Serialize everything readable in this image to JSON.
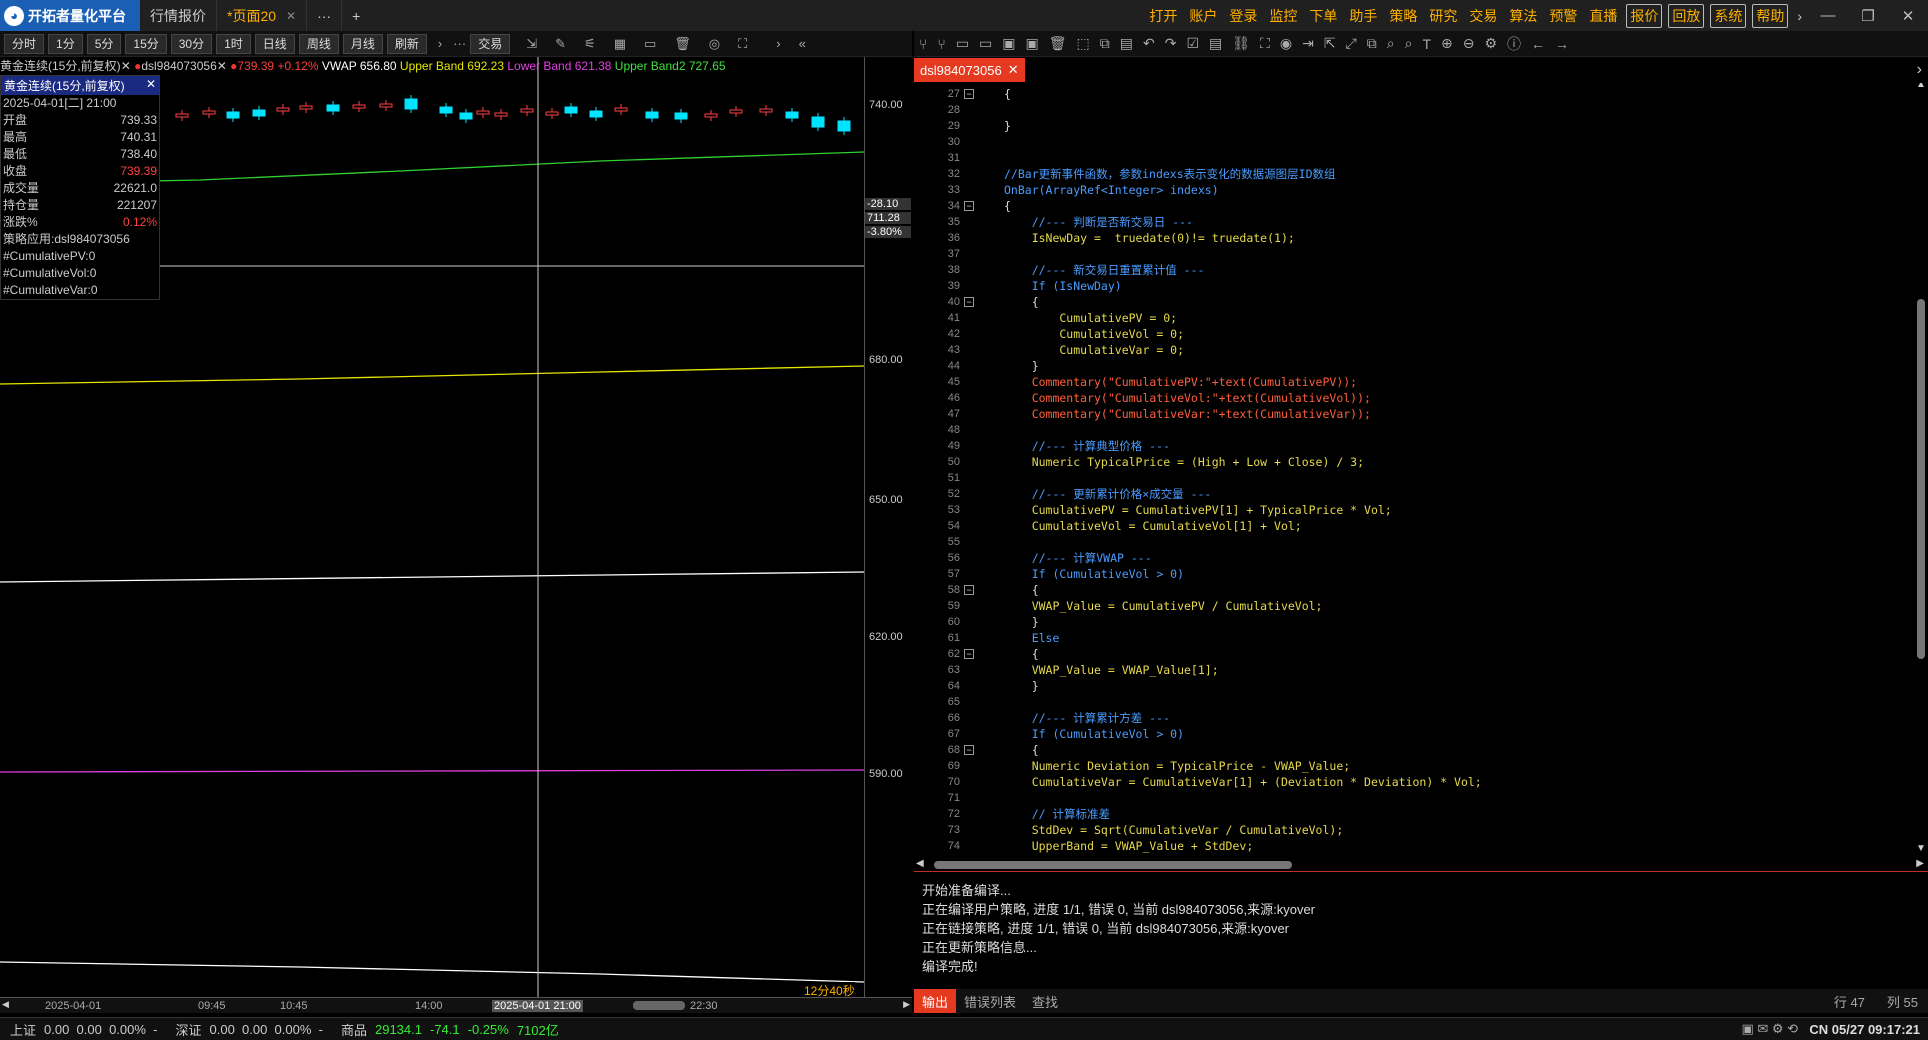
{
  "app": {
    "logo_text": "开拓者量化平台",
    "tabs": [
      {
        "label": "行情报价"
      },
      {
        "label": "*页面20"
      }
    ],
    "more": "···",
    "add": "+"
  },
  "menu": [
    "打开",
    "账户",
    "登录",
    "监控",
    "下单",
    "助手",
    "策略",
    "研究",
    "交易",
    "算法",
    "预警",
    "直播",
    "报价",
    "回放",
    "系统",
    "帮助"
  ],
  "periods": [
    "分时",
    "1分",
    "5分",
    "15分",
    "30分",
    "1时",
    "日线",
    "周线",
    "月线",
    "刷新"
  ],
  "trade_btn": "交易",
  "chart": {
    "legend": {
      "symbol": "黄金连续(15分,前复权)",
      "strategy": "dsl984073056",
      "last": "739.39",
      "chg": "+0.12%",
      "vwap": "VWAP 656.80",
      "upper": "Upper Band 692.23",
      "lower": "Lower Band 621.38",
      "upper2": "Upper Band2 727.65"
    },
    "info": {
      "title": "黄金连续(15分,前复权)",
      "datetime": "2025-04-01[二] 21:00",
      "rows": [
        {
          "label": "开盘",
          "value": "739.33"
        },
        {
          "label": "最高",
          "value": "740.31"
        },
        {
          "label": "最低",
          "value": "738.40"
        },
        {
          "label": "收盘",
          "value": "739.39"
        },
        {
          "label": "成交量",
          "value": "22621.0"
        },
        {
          "label": "持仓量",
          "value": "221207"
        },
        {
          "label": "涨跌%",
          "value": "0.12%"
        }
      ],
      "strategy": "策略应用:dsl984073056",
      "vars": [
        "#CumulativePV:0",
        "#CumulativeVol:0",
        "#CumulativeVar:0"
      ]
    },
    "price_labels": [
      "740.00",
      "680.00",
      "650.00",
      "620.00",
      "590.00"
    ],
    "cursor_labels": [
      "-28.10",
      "711.28",
      "-3.80%"
    ],
    "countdown": "12分40秒",
    "time_labels": [
      "2025-04-01",
      "09:45",
      "10:45",
      "14:00",
      "2025-04-01 21:00",
      "22:30"
    ]
  },
  "status": {
    "sh_label": "上证",
    "sh": "0.00  0.00  0.00%  -",
    "sz_label": "深证",
    "sz": "0.00  0.00  0.00%  -",
    "com_label": "商品",
    "com_val": "29134.1",
    "com_chg": "-74.1",
    "com_pct": "-0.25%",
    "com_amt": "7102亿",
    "right": "CN 05/27 09:17:21"
  },
  "editor": {
    "tab": "dsl984073056",
    "lines": [
      {
        "n": "27",
        "t": "{"
      },
      {
        "n": "28",
        "t": ""
      },
      {
        "n": "29",
        "t": "}"
      },
      {
        "n": "30",
        "t": ""
      },
      {
        "n": "31",
        "t": ""
      },
      {
        "n": "32",
        "t": "//Bar更新事件函数，参数indexs表示变化的数据源图层ID数组"
      },
      {
        "n": "33",
        "t": "OnBar(ArrayRef<Integer> indexs)"
      },
      {
        "n": "34",
        "t": "{"
      },
      {
        "n": "35",
        "t": "    //--- 判断是否新交易日 ---"
      },
      {
        "n": "36",
        "t": "    IsNewDay =  truedate(0)!= truedate(1);"
      },
      {
        "n": "37",
        "t": ""
      },
      {
        "n": "38",
        "t": "    //--- 新交易日重置累计值 ---"
      },
      {
        "n": "39",
        "t": "    If (IsNewDay)"
      },
      {
        "n": "40",
        "t": "    {"
      },
      {
        "n": "41",
        "t": "        CumulativePV = 0;"
      },
      {
        "n": "42",
        "t": "        CumulativeVol = 0;"
      },
      {
        "n": "43",
        "t": "        CumulativeVar = 0;"
      },
      {
        "n": "44",
        "t": "    }"
      },
      {
        "n": "45",
        "t": "    Commentary(\"CumulativePV:\"+text(CumulativePV));"
      },
      {
        "n": "46",
        "t": "    Commentary(\"CumulativeVol:\"+text(CumulativeVol));"
      },
      {
        "n": "47",
        "t": "    Commentary(\"CumulativeVar:\"+text(CumulativeVar));"
      },
      {
        "n": "48",
        "t": ""
      },
      {
        "n": "49",
        "t": "    //--- 计算典型价格 ---"
      },
      {
        "n": "50",
        "t": "    Numeric TypicalPrice = (High + Low + Close) / 3;"
      },
      {
        "n": "51",
        "t": ""
      },
      {
        "n": "52",
        "t": "    //--- 更新累计价格×成交量 ---"
      },
      {
        "n": "53",
        "t": "    CumulativePV = CumulativePV[1] + TypicalPrice * Vol;"
      },
      {
        "n": "54",
        "t": "    CumulativeVol = CumulativeVol[1] + Vol;"
      },
      {
        "n": "55",
        "t": ""
      },
      {
        "n": "56",
        "t": "    //--- 计算VWAP ---"
      },
      {
        "n": "57",
        "t": "    If (CumulativeVol > 0)"
      },
      {
        "n": "58",
        "t": "    {"
      },
      {
        "n": "59",
        "t": "    VWAP_Value = CumulativePV / CumulativeVol;"
      },
      {
        "n": "60",
        "t": "    }"
      },
      {
        "n": "61",
        "t": "    Else"
      },
      {
        "n": "62",
        "t": "    {"
      },
      {
        "n": "63",
        "t": "    VWAP_Value = VWAP_Value[1];"
      },
      {
        "n": "64",
        "t": "    }"
      },
      {
        "n": "65",
        "t": ""
      },
      {
        "n": "66",
        "t": "    //--- 计算累计方差 ---"
      },
      {
        "n": "67",
        "t": "    If (CumulativeVol > 0)"
      },
      {
        "n": "68",
        "t": "    {"
      },
      {
        "n": "69",
        "t": "    Numeric Deviation = TypicalPrice - VWAP_Value;"
      },
      {
        "n": "70",
        "t": "    CumulativeVar = CumulativeVar[1] + (Deviation * Deviation) * Vol;"
      },
      {
        "n": "71",
        "t": ""
      },
      {
        "n": "72",
        "t": "    // 计算标准差"
      },
      {
        "n": "73",
        "t": "    StdDev = Sqrt(CumulativeVar / CumulativeVol);"
      },
      {
        "n": "74",
        "t": "    UpperBand = VWAP_Value + StdDev;"
      }
    ]
  },
  "output": {
    "lines": [
      "开始准备编译...",
      "正在编译用户策略, 进度 1/1, 错误 0, 当前 dsl984073056,来源:kyover",
      "正在链接策略, 进度 1/1, 错误 0, 当前 dsl984073056,来源:kyover",
      "正在更新策略信息...",
      "编译完成!"
    ],
    "tabs": [
      "输出",
      "错误列表",
      "查找"
    ],
    "row": "行 47",
    "col": "列 55"
  },
  "colors": {
    "accent": "#ffb000",
    "tab_red": "#e53a1f",
    "up": "#ff4040",
    "down": "#00e5ff"
  }
}
